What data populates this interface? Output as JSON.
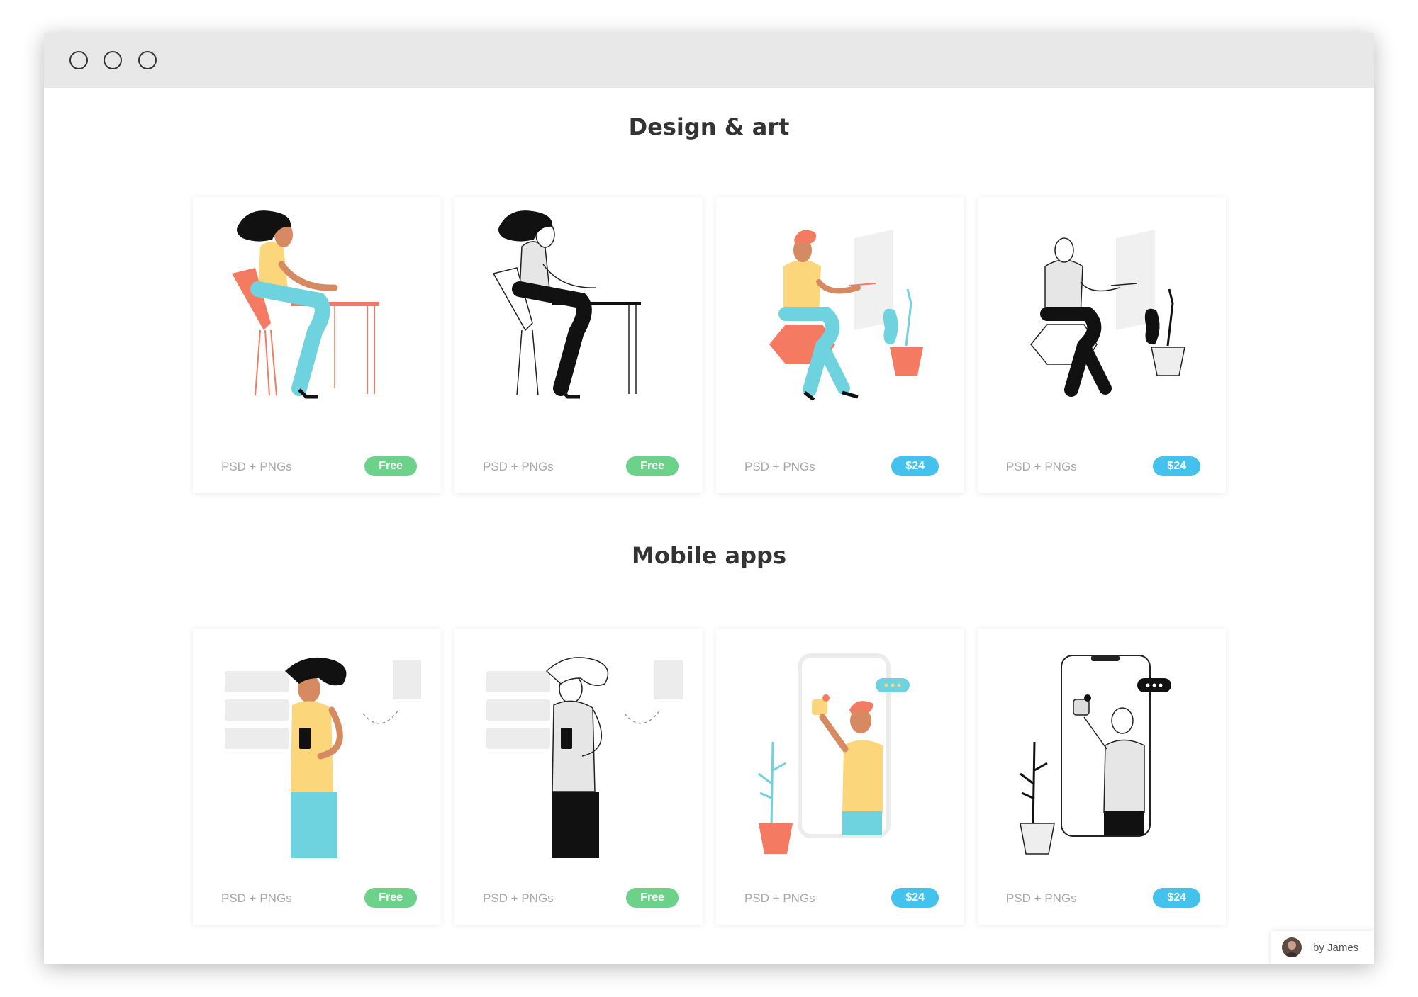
{
  "window": {
    "controls": [
      "close",
      "minimize",
      "maximize"
    ]
  },
  "sections": [
    {
      "title": "Design & art",
      "cards": [
        {
          "format": "PSD + PNGs",
          "price": "Free",
          "style": "color",
          "illustration": "woman-at-desk-drawing"
        },
        {
          "format": "PSD + PNGs",
          "price": "Free",
          "style": "outline",
          "illustration": "woman-at-desk-drawing"
        },
        {
          "format": "PSD + PNGs",
          "price": "$24",
          "style": "color",
          "illustration": "man-drawing-on-canvas"
        },
        {
          "format": "PSD + PNGs",
          "price": "$24",
          "style": "outline",
          "illustration": "man-drawing-on-canvas"
        }
      ]
    },
    {
      "title": "Mobile apps",
      "cards": [
        {
          "format": "PSD + PNGs",
          "price": "Free",
          "style": "color",
          "illustration": "woman-with-phone-checklist"
        },
        {
          "format": "PSD + PNGs",
          "price": "Free",
          "style": "outline",
          "illustration": "woman-with-phone-checklist"
        },
        {
          "format": "PSD + PNGs",
          "price": "$24",
          "style": "color",
          "illustration": "man-inside-smartphone"
        },
        {
          "format": "PSD + PNGs",
          "price": "$24",
          "style": "outline",
          "illustration": "man-inside-smartphone"
        }
      ]
    }
  ],
  "author": {
    "label": "by James"
  },
  "colors": {
    "free_badge": "#6cd28a",
    "paid_badge": "#44c2ee",
    "title_text": "#333333",
    "format_text": "#a8a8a8",
    "coral": "#f47a62",
    "yellow": "#fcd67a",
    "teal": "#6ed3df",
    "skin": "#d68a61"
  }
}
